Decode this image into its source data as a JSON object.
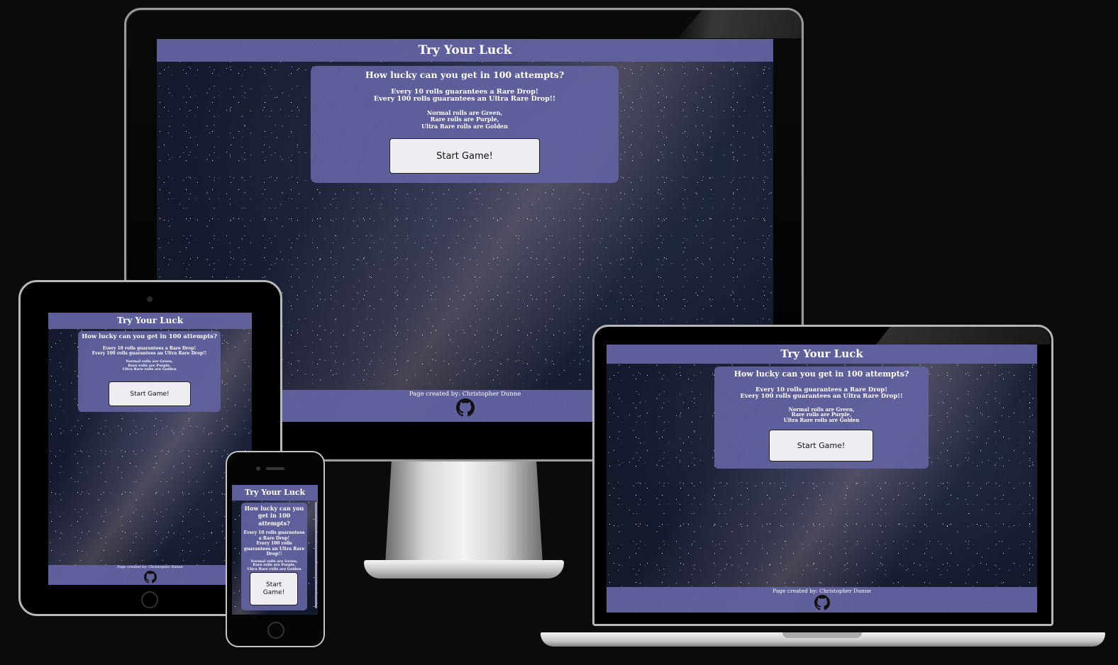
{
  "site": {
    "title": "Try Your Luck",
    "question": "How lucky can you get in 100 attempts?",
    "rule_rare": "Every 10 rolls guarantees a Rare Drop!",
    "rule_ultra": "Every 100 rolls guarantees an Ultra Rare Drop!!",
    "color_normal": "Normal rolls are Green,",
    "color_rare": "Rare rolls are Purple,",
    "color_ultra": "Ultra Rare rolls are Golden",
    "start_label": "Start Game!",
    "footer_credit": "Page created by: Christopher Dunne"
  },
  "icons": {
    "footer_link": "github-icon"
  },
  "colors": {
    "accent": "#6262a0",
    "button_bg": "#eeedf2",
    "page_bg": "#0b0b0b"
  }
}
